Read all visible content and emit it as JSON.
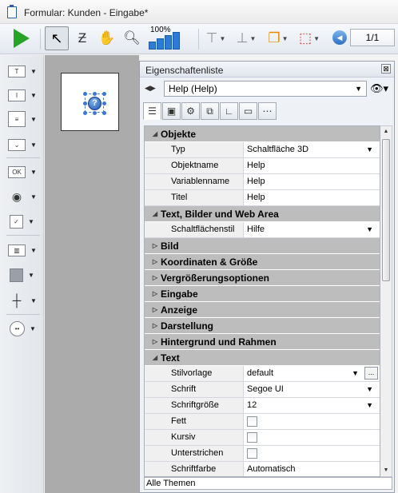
{
  "window": {
    "title": "Formular: Kunden -  Eingabe*"
  },
  "toolbar": {
    "zoom_label": "100%",
    "page_display": "1/1"
  },
  "canvas": {
    "selected_object": "Help"
  },
  "panel": {
    "title": "Eigenschaftenliste",
    "close_glyph": "⊠",
    "object_selector": "Help (Help)",
    "groups": [
      {
        "label": "Objekte",
        "expanded": true,
        "props": [
          {
            "name": "Typ",
            "value": "Schaltfläche 3D",
            "control": "dropdown"
          },
          {
            "name": "Objektname",
            "value": "Help",
            "control": "text"
          },
          {
            "name": "Variablenname",
            "value": "Help",
            "control": "text"
          },
          {
            "name": "Titel",
            "value": "Help",
            "control": "text"
          }
        ]
      },
      {
        "label": "Text, Bilder und Web Area",
        "expanded": true,
        "props": [
          {
            "name": "Schaltflächenstil",
            "value": "Hilfe",
            "control": "dropdown"
          }
        ]
      },
      {
        "label": "Bild",
        "expanded": false,
        "props": []
      },
      {
        "label": "Koordinaten & Größe",
        "expanded": false,
        "props": []
      },
      {
        "label": "Vergrößerungsoptionen",
        "expanded": false,
        "props": []
      },
      {
        "label": "Eingabe",
        "expanded": false,
        "props": []
      },
      {
        "label": "Anzeige",
        "expanded": false,
        "props": []
      },
      {
        "label": "Darstellung",
        "expanded": false,
        "props": []
      },
      {
        "label": "Hintergrund und Rahmen",
        "expanded": false,
        "props": []
      },
      {
        "label": "Text",
        "expanded": true,
        "props": [
          {
            "name": "Stilvorlage",
            "value": "default",
            "control": "dropdown-dots"
          },
          {
            "name": "Schrift",
            "value": "Segoe UI",
            "control": "dropdown"
          },
          {
            "name": "Schriftgröße",
            "value": "12",
            "control": "dropdown"
          },
          {
            "name": "Fett",
            "value": "",
            "control": "checkbox"
          },
          {
            "name": "Kursiv",
            "value": "",
            "control": "checkbox"
          },
          {
            "name": "Unterstrichen",
            "value": "",
            "control": "checkbox"
          },
          {
            "name": "Schriftfarbe",
            "value": "Automatisch",
            "control": "text"
          }
        ]
      }
    ],
    "status": "Alle Themen"
  },
  "colors": {
    "group_header": "#bdbdbd",
    "accent": "#2c7bd6",
    "canvas": "#ababab"
  }
}
